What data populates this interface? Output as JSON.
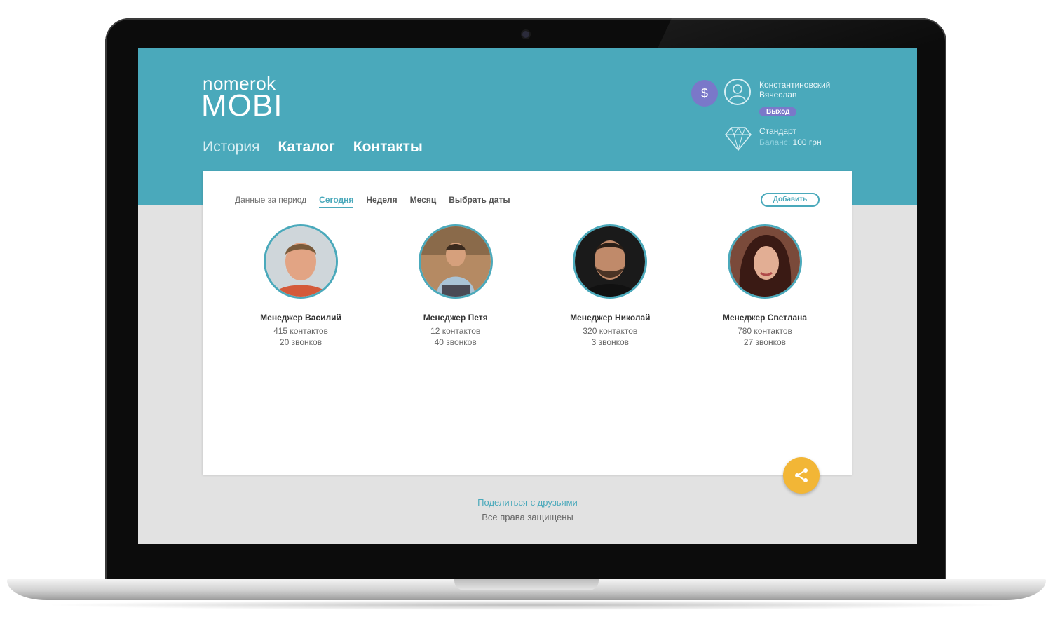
{
  "brand": {
    "line1": "nomerok",
    "line2": "MOBI"
  },
  "nav": [
    {
      "label": "История"
    },
    {
      "label": "Каталог"
    },
    {
      "label": "Контакты"
    }
  ],
  "account": {
    "balance_icon": "$",
    "user_name": "Константиновский Вячеслав",
    "logout_label": "Выход",
    "plan_name": "Стандарт",
    "balance_label": "Баланс:",
    "balance_value": "100 грн"
  },
  "filters": {
    "label": "Данные за период",
    "options": [
      "Сегодня",
      "Неделя",
      "Месяц",
      "Выбрать даты"
    ],
    "active": "Сегодня"
  },
  "add_button": "Добавить",
  "managers": [
    {
      "name": "Менеджер Василий",
      "contacts": "415 контактов",
      "calls": "20 звонков"
    },
    {
      "name": "Менеджер Петя",
      "contacts": "12 контактов",
      "calls": "40 звонков"
    },
    {
      "name": "Менеджер Николай",
      "contacts": "320 контактов",
      "calls": "3 звонков"
    },
    {
      "name": "Менеджер Светлана",
      "contacts": "780 контактов",
      "calls": "27 звонков"
    }
  ],
  "footer": {
    "share_link": "Поделиться с друзьями",
    "rights": "Все права защищены"
  },
  "colors": {
    "accent": "#4aa9bb",
    "purple": "#7a78c9",
    "share_fab": "#f2b636"
  },
  "icons": [
    "dollar-icon",
    "user-icon",
    "diamond-icon",
    "share-icon"
  ]
}
